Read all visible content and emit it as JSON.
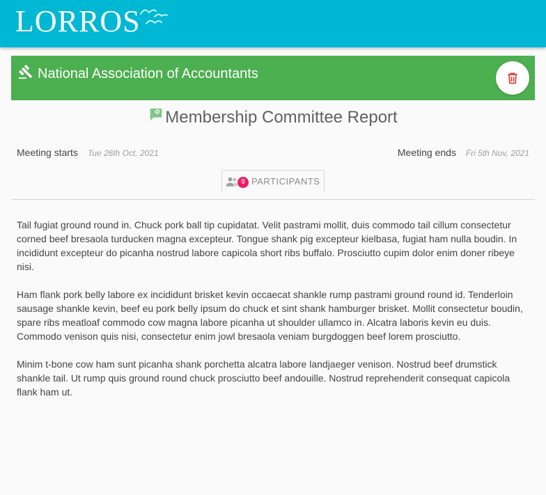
{
  "header": {
    "logo_text": "LORROS",
    "brand_color": "#00b8d4"
  },
  "organization": {
    "icon": "gavel-icon",
    "name": "National Association of Accountants",
    "color": "#4caf50",
    "delete_icon": "trash-icon",
    "delete_color": "#e53935"
  },
  "report": {
    "icon": "comment-icon",
    "title": "Membership Committee Report"
  },
  "meeting": {
    "starts_label": "Meeting starts",
    "starts_date": "Tue 26th Oct, 2021",
    "ends_label": "Meeting ends",
    "ends_date": "Fri 5th Nov, 2021"
  },
  "participants": {
    "icon": "people-icon",
    "count": "9",
    "label": "PARTICIPANTS",
    "badge_color": "#e91e63"
  },
  "content": {
    "paragraphs": [
      "Tail fugiat ground round in. Chuck pork ball tip cupidatat. Velit pastrami mollit, duis commodo tail cillum consectetur corned beef bresaola turducken magna excepteur. Tongue shank pig excepteur kielbasa, fugiat ham nulla boudin. In incididunt excepteur do picanha nostrud labore capicola short ribs buffalo. Prosciutto cupim dolor enim doner ribeye nisi.",
      "Ham flank pork belly labore ex incididunt brisket kevin occaecat shankle rump pastrami ground round id. Tenderloin sausage shankle kevin, beef eu pork belly ipsum do chuck et sint shank hamburger brisket. Mollit consectetur boudin, spare ribs meatloaf commodo cow magna labore picanha ut shoulder ullamco in. Alcatra laboris kevin eu duis. Commodo venison quis nisi, consectetur enim jowl bresaola veniam burgdoggen beef lorem prosciutto.",
      "Minim t-bone cow ham sunt picanha shank porchetta alcatra labore landjaeger venison. Nostrud beef drumstick shankle tail. Ut rump quis ground round chuck prosciutto beef andouille. Nostrud reprehenderit consequat capicola flank ham ut."
    ]
  }
}
